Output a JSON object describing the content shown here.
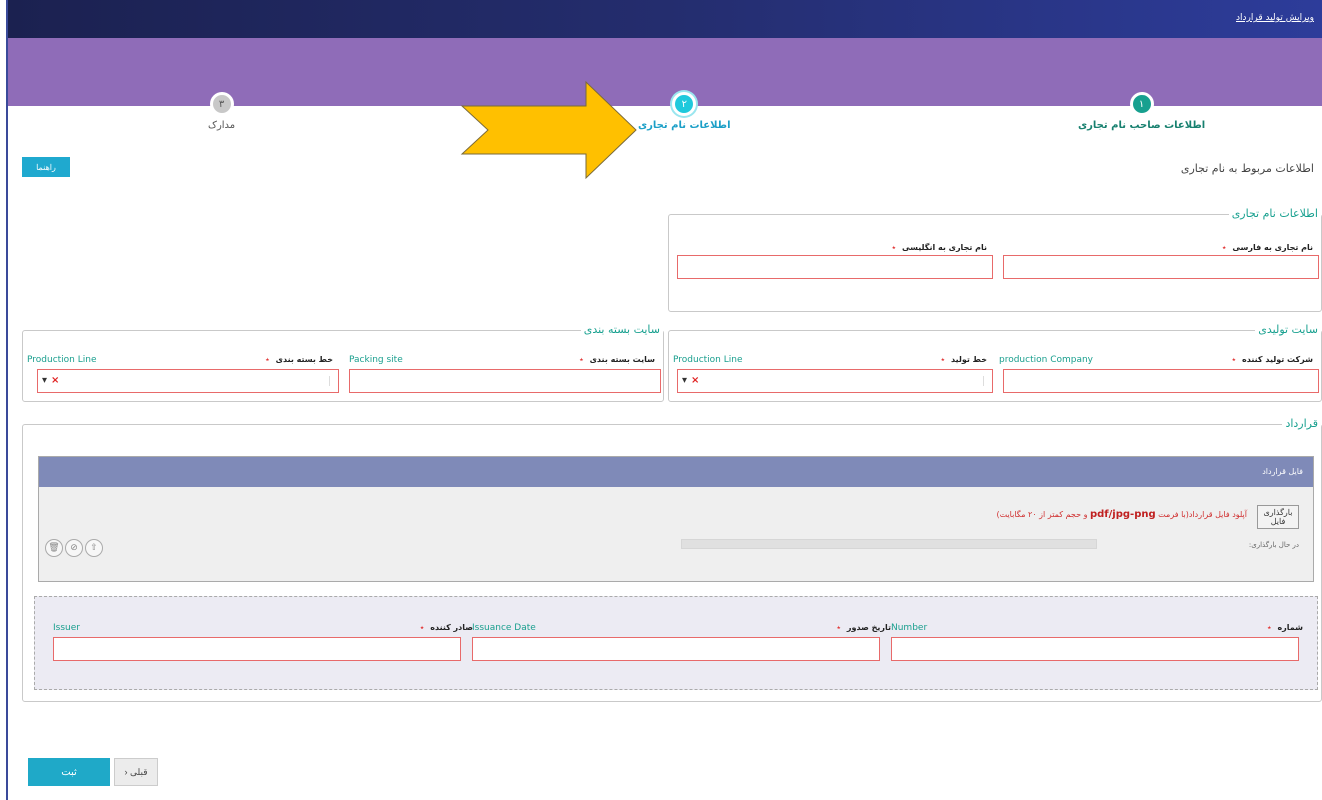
{
  "header": {
    "title": "ویرایش تولید قرارداد"
  },
  "wizard": {
    "steps": [
      {
        "number": "۱",
        "label": "اطلاعات صاحب نام تجاری"
      },
      {
        "number": "۲",
        "label": "اطلاعات نام تجاری"
      },
      {
        "number": "۳",
        "label": "مدارک"
      }
    ]
  },
  "help_button": "راهنما",
  "section_heading": "اطلاعات مربوط به نام تجاری",
  "brand_info": {
    "legend": "اطلاعات نام تجاری",
    "persian_name_label": "نام تجاری به فارسی",
    "english_name_label": "نام تجاری به انگلیسی"
  },
  "production_site": {
    "legend": "سایت تولیدی",
    "producer_label": "شرکت تولید کننده",
    "producer_en": "production Company",
    "line_label": "خط تولید",
    "line_en": "Production Line"
  },
  "packing_site": {
    "legend": "سایت بسته بندی",
    "site_label": "سایت بسته بندی",
    "site_en": "Packing site",
    "line_label": "خط بسته بندی",
    "line_en": "Production Line"
  },
  "contract": {
    "legend": "قرارداد",
    "panel_title": "فایل قرارداد",
    "upload_button": "بارگذاری فایل",
    "upload_note_a": "آپلود فایل قرارداد(با فرمت ",
    "upload_formats": "pdf/jpg-png",
    "upload_note_b": " و حجم کمتر از ۲۰ مگابایت)",
    "loading": "در حال بارگذاری:",
    "number_label": "شماره",
    "number_en": "Number",
    "date_label": "تاریخ صدور",
    "date_en": "Issuance Date",
    "issuer_label": "صادر کننده",
    "issuer_en": "Issuer"
  },
  "footer": {
    "submit": "ثبت",
    "prev": "قبلی"
  },
  "colors": {
    "accent": "#1fa9c8",
    "purple_band": "#8f6cb8",
    "required": "#e23a3a",
    "arrow": "#ffc000"
  }
}
